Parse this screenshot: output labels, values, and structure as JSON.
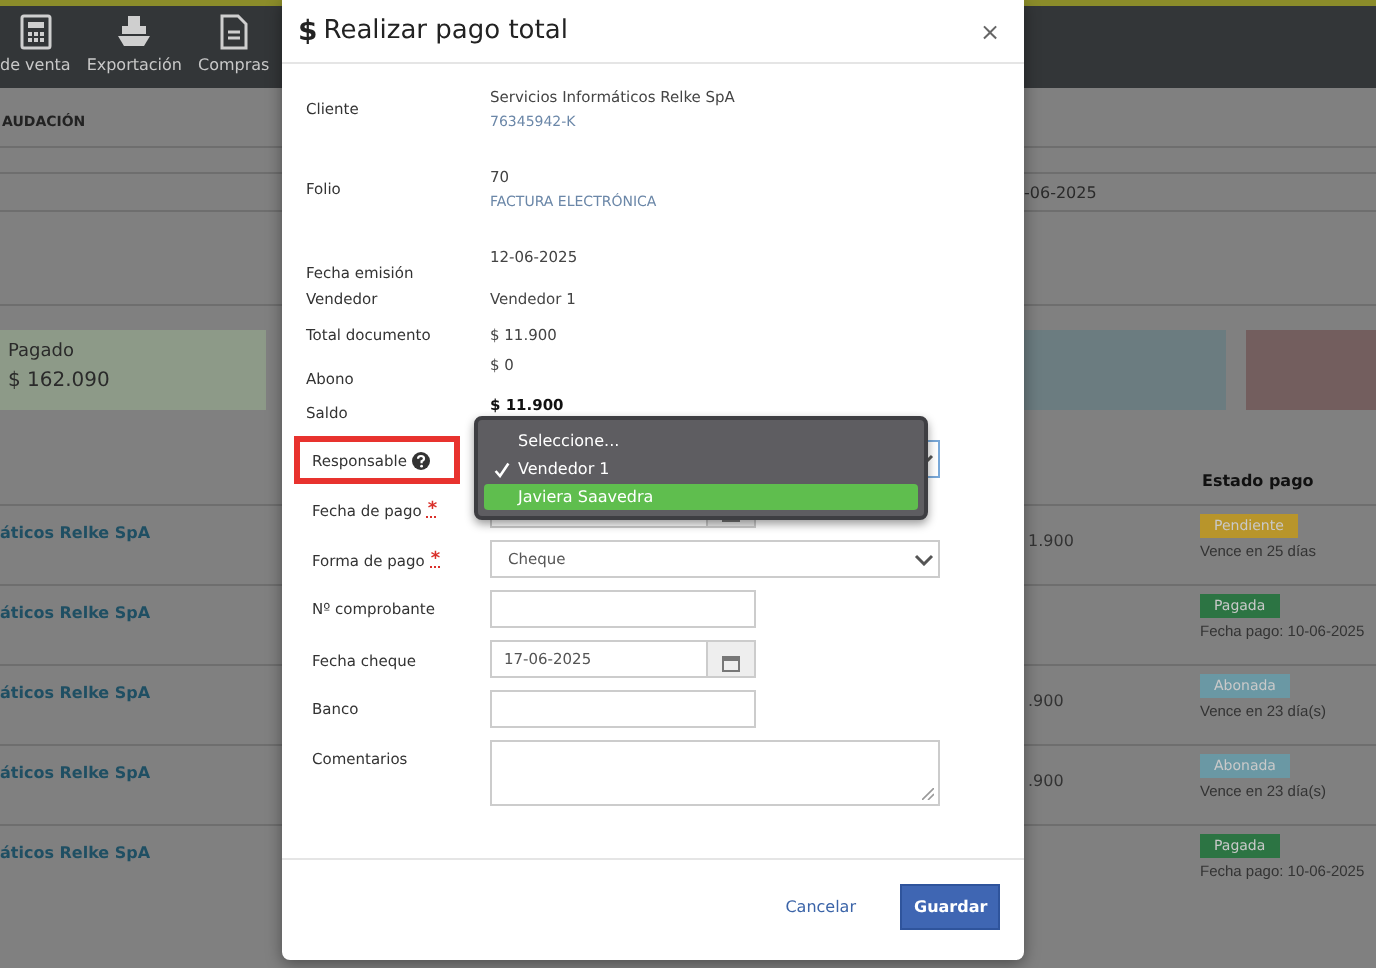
{
  "nav": [
    {
      "label": "de venta"
    },
    {
      "label": "Exportación"
    },
    {
      "label": "Compras"
    }
  ],
  "background": {
    "section_title": "AUDACIÓN",
    "date": "-06-2025",
    "cards": [
      {
        "label": "Pagado",
        "amount": "$ 162.090",
        "color": "#8d9a88"
      },
      {
        "color": "#6b7c80"
      },
      {
        "color": "#735e5e"
      }
    ]
  },
  "table": {
    "header": "Estado pago",
    "rows": [
      {
        "client": "áticos Relke SpA",
        "amount": "1.900",
        "status": "Pendiente",
        "color": "#b8952b",
        "note": "Vence en 25 días"
      },
      {
        "client": "áticos Relke SpA",
        "status": "Pagada",
        "color": "#2c7443",
        "note": "Fecha pago: 10-06-2025"
      },
      {
        "client": "áticos Relke SpA",
        "amount": ".900",
        "status": "Abonada",
        "color": "#6a98a4",
        "note": "Vence en 23 día(s)"
      },
      {
        "client": "áticos Relke SpA",
        "amount": ".900",
        "status": "Abonada",
        "color": "#6a98a4",
        "note": "Vence en 23 día(s)"
      },
      {
        "client": "áticos Relke SpA",
        "status": "Pagada",
        "color": "#2c7443",
        "note": "Fecha pago: 10-06-2025"
      }
    ]
  },
  "modal": {
    "title_icon": "$",
    "title": "Realizar pago total",
    "close": "×",
    "info": [
      {
        "label": "Cliente",
        "lines": [
          {
            "text": "Servicios Informáticos Relke SpA",
            "kind": "primary"
          },
          {
            "text": "76345942-K",
            "kind": "secondary"
          }
        ]
      },
      {
        "label": "Folio",
        "lines": [
          {
            "text": "70",
            "kind": "primary"
          },
          {
            "text": "FACTURA ELECTRÓNICA",
            "kind": "secondary"
          }
        ]
      },
      {
        "label": "Fecha emisión",
        "lines": [
          {
            "text": "12-06-2025",
            "kind": "primary"
          }
        ]
      },
      {
        "label": "Vendedor",
        "lines": [
          {
            "text": "Vendedor 1",
            "kind": "primary"
          }
        ]
      },
      {
        "label": "Total documento",
        "lines": [
          {
            "text": "$ 11.900",
            "kind": "primary"
          }
        ]
      },
      {
        "label": "Abono",
        "lines": [
          {
            "text": "$ 0",
            "kind": "primary"
          }
        ]
      },
      {
        "label": "Saldo",
        "lines": [
          {
            "text": "$ 11.900",
            "kind": "bold"
          }
        ]
      }
    ],
    "fields": [
      {
        "label": "Responsable",
        "kind": "select",
        "help": true,
        "highlighted": true,
        "focused": true
      },
      {
        "label": "Fecha de pago",
        "kind": "date",
        "required_mark": "*",
        "highlighted": false,
        "focused": false
      },
      {
        "label": "Forma de pago",
        "kind": "select",
        "required_mark": "*",
        "value": "Cheque",
        "highlighted": false,
        "focused": false
      },
      {
        "label": "Nº comprobante",
        "kind": "text",
        "highlighted": false,
        "focused": false
      },
      {
        "label": "Fecha cheque",
        "kind": "date",
        "value": "17-06-2025",
        "highlighted": false,
        "focused": false
      },
      {
        "label": "Banco",
        "kind": "text",
        "highlighted": false,
        "focused": false
      },
      {
        "label": "Comentarios",
        "kind": "textarea",
        "highlighted": false,
        "focused": false
      }
    ],
    "dropdown": [
      {
        "label": "Seleccione...",
        "checked": false,
        "highlighted": false
      },
      {
        "label": "Vendedor 1",
        "checked": true,
        "highlighted": false
      },
      {
        "label": "Javiera Saavedra",
        "checked": false,
        "highlighted": true
      }
    ],
    "buttons": {
      "cancel": "Cancelar",
      "save": "Guardar"
    }
  }
}
